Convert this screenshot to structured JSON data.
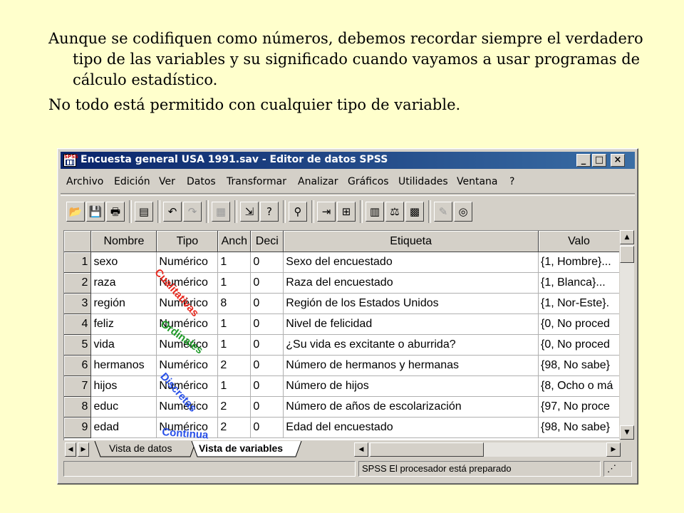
{
  "slide": {
    "paragraph1": "Aunque se codifiquen como números, debemos recordar siempre el verdadero tipo de las variables y su significado cuando vayamos a usar programas de cálculo estadístico.",
    "paragraph2": "No todo está permitido con cualquier tipo de variable."
  },
  "window": {
    "title": "Encuesta general USA 1991.sav - Editor de datos SPSS",
    "minimize": "_",
    "maximize": "□",
    "close": "×",
    "icon_text": "SPSS"
  },
  "menu": [
    "Archivo",
    "Edición",
    "Ver",
    "Datos",
    "Transformar",
    "Analizar",
    "Gráficos",
    "Utilidades",
    "Ventana",
    "?"
  ],
  "grid": {
    "columns": [
      "Nombre",
      "Tipo",
      "Anch",
      "Deci",
      "Etiqueta",
      "Valo"
    ],
    "rows": [
      {
        "num": "1",
        "name": "sexo",
        "type": "Numérico",
        "width": "1",
        "dec": "0",
        "label": "Sexo del encuestado",
        "values": "{1, Hombre}..."
      },
      {
        "num": "2",
        "name": "raza",
        "type": "Numérico",
        "width": "1",
        "dec": "0",
        "label": "Raza del encuestado",
        "values": "{1, Blanca}..."
      },
      {
        "num": "3",
        "name": "región",
        "type": "Numérico",
        "width": "8",
        "dec": "0",
        "label": "Región de los Estados Unidos",
        "values": "{1, Nor-Este}."
      },
      {
        "num": "4",
        "name": "feliz",
        "type": "Numérico",
        "width": "1",
        "dec": "0",
        "label": "Nivel de felicidad",
        "values": "{0, No proced"
      },
      {
        "num": "5",
        "name": "vida",
        "type": "Numérico",
        "width": "1",
        "dec": "0",
        "label": "¿Su vida es excitante o aburrida?",
        "values": "{0, No proced"
      },
      {
        "num": "6",
        "name": "hermanos",
        "type": "Numérico",
        "width": "2",
        "dec": "0",
        "label": "Número de hermanos y hermanas",
        "values": "{98, No sabe}"
      },
      {
        "num": "7",
        "name": "hijos",
        "type": "Numérico",
        "width": "1",
        "dec": "0",
        "label": "Número de hijos",
        "values": "{8, Ocho o má"
      },
      {
        "num": "8",
        "name": "educ",
        "type": "Numérico",
        "width": "2",
        "dec": "0",
        "label": "Número de años de escolarización",
        "values": "{97, No proce"
      },
      {
        "num": "9",
        "name": "edad",
        "type": "Numérico",
        "width": "2",
        "dec": "0",
        "label": "Edad del encuestado",
        "values": "{98, No sabe}"
      }
    ]
  },
  "annotations": [
    {
      "text": "Cualitativas",
      "color": "#e8281e"
    },
    {
      "text": "Ordinales",
      "color": "#1e9a28"
    },
    {
      "text": "Discretas",
      "color": "#2850e8"
    },
    {
      "text": "Continua",
      "color": "#2850e8"
    }
  ],
  "tabs": {
    "data_view": "Vista de datos",
    "variable_view": "Vista de variables"
  },
  "status": {
    "message": "SPSS El procesador  está preparado"
  }
}
